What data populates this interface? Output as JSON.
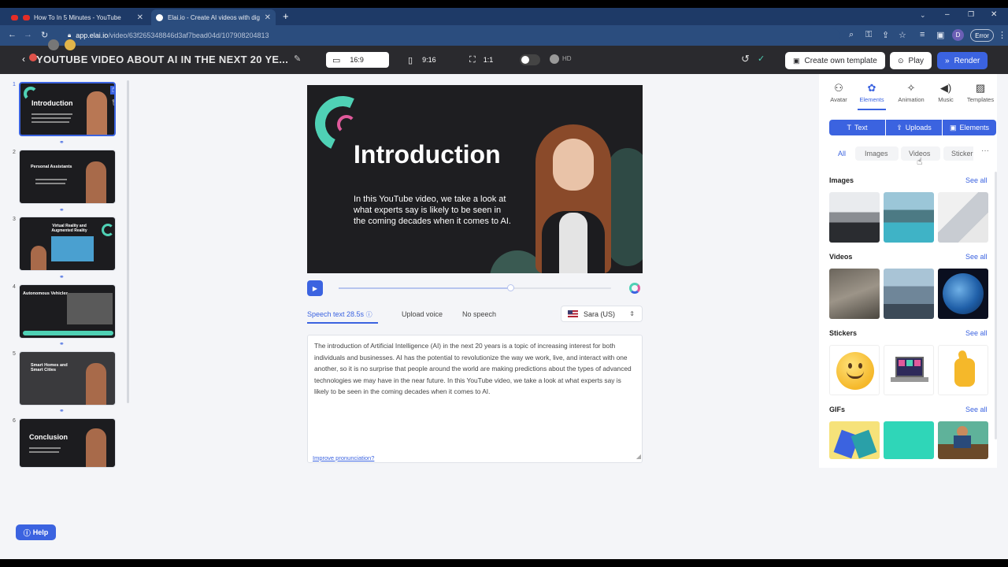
{
  "browser": {
    "tabs": [
      {
        "label": "How To In 5 Minutes - YouTube"
      },
      {
        "label": "Elai.io - Create AI videos with dig"
      }
    ],
    "url_host": "app.elai.io",
    "url_path": "/video/63f265348846d3af7bead04d/107908204813",
    "profile_initial": "D",
    "error_label": "Error"
  },
  "header": {
    "title": "YOUTUBE VIDEO ABOUT AI IN THE NEXT 20 YE...",
    "ratio_169": "16:9",
    "ratio_916": "9:16",
    "ratio_11": "1:1",
    "hd_label": "HD",
    "create_template": "Create own template",
    "play": "Play",
    "render": "Render"
  },
  "slides": [
    {
      "num": "1",
      "title": "Introduction"
    },
    {
      "num": "2",
      "title": "Personal Assistants"
    },
    {
      "num": "3",
      "title": "Virtual Reality and Augmented Reality"
    },
    {
      "num": "4",
      "title": "Autonomous Vehicles"
    },
    {
      "num": "5",
      "title": "Smart Homes and Smart Cities"
    },
    {
      "num": "6",
      "title": "Conclusion"
    }
  ],
  "canvas": {
    "title": "Introduction",
    "body": "In this YouTube video, we take a look at what experts say is likely to be seen in the coming decades when it comes to AI."
  },
  "speech": {
    "tab_speech": "Speech text 28.5s",
    "tab_upload": "Upload voice",
    "tab_none": "No speech",
    "voice": "Sara (US)",
    "text": "The introduction of Artificial Intelligence (AI) in the next 20 years is a topic of increasing interest for both individuals and businesses. AI has the potential to revolutionize the way we work, live, and interact with one another, so it is no surprise that people around the world are making predictions about the types of advanced technologies we may have in the near future. In this YouTube video, we take a look at what experts say is likely to be seen in the coming decades when it comes to AI.",
    "improve": "Improve pronunciation?",
    "progress": 0.63
  },
  "right": {
    "tabs": [
      "Avatar",
      "Elements",
      "Animation",
      "Music",
      "Templates"
    ],
    "seg": [
      "Text",
      "Uploads",
      "Elements"
    ],
    "filters": [
      "All",
      "Images",
      "Videos",
      "Sticker"
    ],
    "sections": [
      "Images",
      "Videos",
      "Stickers",
      "GIFs"
    ],
    "see_all": "See all"
  },
  "help": "Help",
  "colors": {
    "accent": "#3b63e0",
    "header": "#2a2a2e",
    "teal": "#4fd1b5"
  }
}
